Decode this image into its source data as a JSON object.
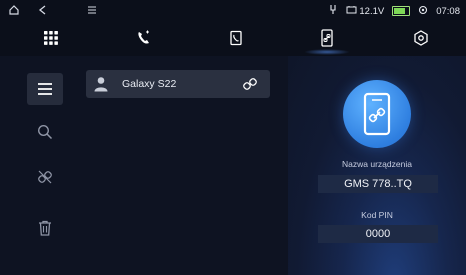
{
  "statusbar": {
    "voltage": "12.1V",
    "time": "07:08",
    "icons": [
      "home-icon",
      "back-icon",
      "notification-icon",
      "usb-icon",
      "car-battery-icon",
      "battery-icon",
      "location-icon"
    ]
  },
  "nav": {
    "items": [
      {
        "name": "apps-grid-icon"
      },
      {
        "name": "phone-icon"
      },
      {
        "name": "contacts-icon"
      },
      {
        "name": "phone-link-icon",
        "active": true
      },
      {
        "name": "settings-icon"
      }
    ]
  },
  "sidebar": {
    "items": [
      {
        "name": "menu-icon",
        "selected": true
      },
      {
        "name": "search-icon"
      },
      {
        "name": "unlink-icon"
      },
      {
        "name": "trash-icon"
      }
    ]
  },
  "devices": [
    {
      "name": "Galaxy S22",
      "icon": "user-icon",
      "action_icon": "link-icon"
    }
  ],
  "panel": {
    "device_name_label": "Nazwa urządzenia",
    "device_name_value": "GMS 778..TQ",
    "pin_label": "Kod PIN",
    "pin_value": "0000"
  },
  "colors": {
    "background": "#0e1322",
    "accent": "#2f7fe0",
    "row": "#2a3040"
  }
}
